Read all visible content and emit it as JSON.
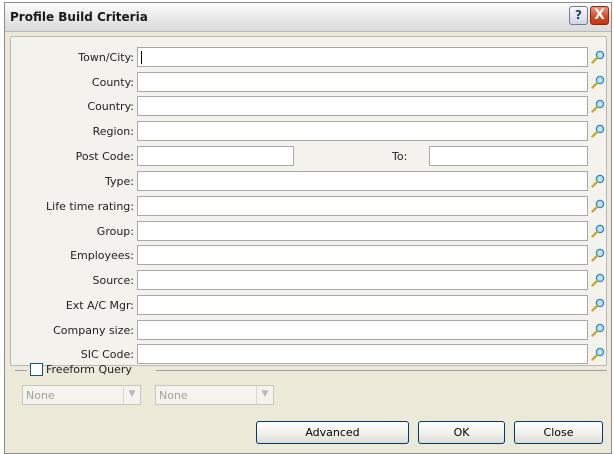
{
  "window": {
    "title": "Profile Build Criteria",
    "help_label": "?",
    "close_label": "X"
  },
  "fields": [
    {
      "label": "Town/City:",
      "value": ""
    },
    {
      "label": "County:",
      "value": ""
    },
    {
      "label": "Country:",
      "value": ""
    },
    {
      "label": "Region:",
      "value": ""
    },
    {
      "label": "Post Code:",
      "value": ""
    },
    {
      "label": "Type:",
      "value": ""
    },
    {
      "label": "Life time rating:",
      "value": ""
    },
    {
      "label": "Group:",
      "value": ""
    },
    {
      "label": "Employees:",
      "value": ""
    },
    {
      "label": "Source:",
      "value": ""
    },
    {
      "label": "Ext A/C Mgr:",
      "value": ""
    },
    {
      "label": "Company size:",
      "value": ""
    },
    {
      "label": "SIC Code:",
      "value": ""
    }
  ],
  "postcode_to_label": "To:",
  "freeform": {
    "label": "Freeform Query",
    "checked": false,
    "select1": "None",
    "select2": "None"
  },
  "buttons": {
    "advanced": "Advanced",
    "ok": "OK",
    "close": "Close"
  },
  "icons": {
    "lookup": "magnifier-icon"
  }
}
